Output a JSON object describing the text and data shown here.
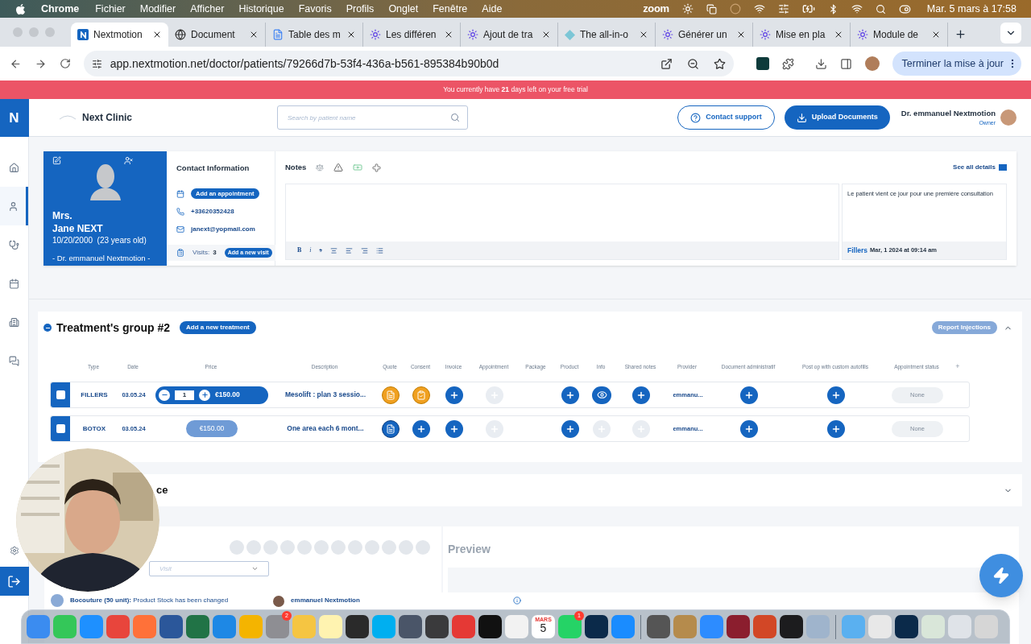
{
  "menu_bar": {
    "app": "Chrome",
    "menus": [
      "Fichier",
      "Modifier",
      "Afficher",
      "Historique",
      "Favoris",
      "Profils",
      "Onglet",
      "Fenêtre",
      "Aide"
    ],
    "zoom_label": "zoom",
    "clock": "Mar. 5 mars à 17:58"
  },
  "browser": {
    "tabs": [
      {
        "title": "Nextmotion",
        "kind": "nextmotion",
        "selected": true
      },
      {
        "title": "Document",
        "kind": "globe",
        "selected": false
      },
      {
        "title": "Table des m",
        "kind": "docs",
        "selected": false
      },
      {
        "title": "Les différen",
        "kind": "sparkle",
        "selected": false
      },
      {
        "title": "Ajout de tra",
        "kind": "sparkle",
        "selected": false
      },
      {
        "title": "The all-in-o",
        "kind": "diamond",
        "selected": false
      },
      {
        "title": "Générer un",
        "kind": "sparkle",
        "selected": false
      },
      {
        "title": "Mise en pla",
        "kind": "sparkle",
        "selected": false
      },
      {
        "title": "Module de",
        "kind": "sparkle",
        "selected": false
      }
    ],
    "url": "app.nextmotion.net/doctor/patients/79266d7b-53f4-436a-b561-895384b90b0d",
    "update_button": "Terminer la mise à jour"
  },
  "trial_banner": "You currently have **21** days left on your free trial",
  "sidebar": {
    "logo": "N",
    "items": [
      {
        "kind": "home",
        "selected": false
      },
      {
        "kind": "user",
        "selected": true
      },
      {
        "kind": "stethoscope",
        "selected": false
      },
      {
        "kind": "calendar",
        "selected": false
      },
      {
        "kind": "building",
        "selected": false
      },
      {
        "kind": "chat",
        "selected": false
      }
    ]
  },
  "header": {
    "clinic": "Next Clinic",
    "search_placeholder": "Search by patient name",
    "contact_support": "Contact support",
    "upload": "Upload Documents",
    "user_name": "Dr. emmanuel Nextmotion",
    "user_role": "Owner"
  },
  "patient": {
    "title": "Mrs.",
    "name": "Jane NEXT",
    "birth": "10/20/2000  (23 years old)",
    "doctor": "- Dr. emmanuel Nextmotion -"
  },
  "contact": {
    "heading": "Contact Information",
    "appointment_button": "Add an appointment",
    "phone": "+33620352428",
    "email": "janext@yopmail.com",
    "visits_label": "Visits:",
    "visits_count": "3",
    "visit_button": "Add a new visit"
  },
  "notes": {
    "title": "Notes",
    "format_buttons": [
      "B",
      "i",
      "s"
    ],
    "see_all": "See all details",
    "last_note": {
      "text": "Le patient vient ce jour pour une première consultation",
      "tag": "Fillers",
      "date": "Mar, 1 2024 at 09:14 am"
    }
  },
  "treatment_group": {
    "title": "Treatment's group #2",
    "add_button": "Add a new treatment",
    "report_button": "Report Injections",
    "expanded": true,
    "columns": [
      "Type",
      "Date",
      "Price",
      "Description",
      "Quote",
      "Consent",
      "Invoice",
      "Appointment",
      "Package",
      "Product",
      "Info",
      "Shared notes",
      "Provider",
      "Document administratif",
      "Post op with custom autofills",
      "Appointment status",
      "+"
    ],
    "rows": [
      {
        "checked": false,
        "type": "FILLERS",
        "date": "03.05.24",
        "price": {
          "kind": "stepper",
          "quantity": "1",
          "amount": "€150.00"
        },
        "description": "Mesolift : plan 3 sessio...",
        "actions": [
          {
            "kind": "document",
            "completed": true
          },
          {
            "kind": "checklist",
            "completed": true
          },
          {
            "kind": "add",
            "disabled": false
          },
          {
            "kind": "add",
            "disabled": true
          },
          {
            "kind": "empty"
          },
          {
            "kind": "add",
            "disabled": false
          },
          {
            "kind": "view",
            "disabled": false
          },
          {
            "kind": "add",
            "disabled": false
          }
        ],
        "provider": "emmanu...",
        "post_actions": [
          {
            "kind": "add",
            "disabled": false
          },
          {
            "kind": "add",
            "disabled": false
          }
        ],
        "status": "None"
      },
      {
        "checked": false,
        "type": "BOTOX",
        "date": "03.05.24",
        "price": {
          "kind": "pill",
          "amount": "€150.00"
        },
        "description": "One area each 6 mont...",
        "actions": [
          {
            "kind": "document",
            "completed": false
          },
          {
            "kind": "add",
            "disabled": false
          },
          {
            "kind": "add",
            "disabled": false
          },
          {
            "kind": "add",
            "disabled": true
          },
          {
            "kind": "empty"
          },
          {
            "kind": "add",
            "disabled": false
          },
          {
            "kind": "add",
            "disabled": true
          },
          {
            "kind": "add",
            "disabled": true
          }
        ],
        "provider": "emmanu...",
        "post_actions": [
          {
            "kind": "add",
            "disabled": false
          },
          {
            "kind": "add",
            "disabled": false
          }
        ],
        "status": "None"
      }
    ]
  },
  "collapsed_section": {
    "title": "ce",
    "expanded": false
  },
  "visit_panel": {
    "visit_placeholder": "Visit",
    "preview_title": "Preview",
    "activity": {
      "text": "**Bocouture (50 unit):** Product Stock has been changed",
      "author": "emmanuel Nextmotion"
    }
  },
  "dock": [
    {
      "kind": "app",
      "color": "#3b8cf0"
    },
    {
      "kind": "app",
      "color": "#34c759"
    },
    {
      "kind": "app",
      "color": "#1e90ff"
    },
    {
      "kind": "app",
      "color": "#e8453c"
    },
    {
      "kind": "app",
      "color": "#ff7139"
    },
    {
      "kind": "app",
      "color": "#2b579a"
    },
    {
      "kind": "app",
      "color": "#217346"
    },
    {
      "kind": "app",
      "color": "#1e88e5"
    },
    {
      "kind": "app",
      "color": "#f4b400"
    },
    {
      "kind": "app",
      "color": "#8e8e93",
      "badge": "2"
    },
    {
      "kind": "app",
      "color": "#f5c542"
    },
    {
      "kind": "app",
      "color": "#fff3b0"
    },
    {
      "kind": "app",
      "color": "#2a2a2a"
    },
    {
      "kind": "app",
      "color": "#00aff0"
    },
    {
      "kind": "app",
      "color": "#4a5568"
    },
    {
      "kind": "app",
      "color": "#3a3a3c"
    },
    {
      "kind": "app",
      "color": "#e53935"
    },
    {
      "kind": "app",
      "color": "#111111"
    },
    {
      "kind": "app",
      "color": "#f2f2f2"
    },
    {
      "kind": "calendar",
      "month": "MARS",
      "day": "5"
    },
    {
      "kind": "app",
      "color": "#25d366",
      "badge": "1"
    },
    {
      "kind": "app",
      "color": "#0b2a4a"
    },
    {
      "kind": "app",
      "color": "#1a8cff"
    },
    {
      "kind": "separator"
    },
    {
      "kind": "app",
      "color": "#555555"
    },
    {
      "kind": "app",
      "color": "#b58b4c"
    },
    {
      "kind": "app",
      "color": "#2d8cff"
    },
    {
      "kind": "app",
      "color": "#8b1e2e"
    },
    {
      "kind": "app",
      "color": "#d24726"
    },
    {
      "kind": "app",
      "color": "#1c1c1e"
    },
    {
      "kind": "app",
      "color": "#9fb4cc"
    },
    {
      "kind": "separator"
    },
    {
      "kind": "app",
      "color": "#5ab0f0"
    },
    {
      "kind": "app",
      "color": "#e8e8e8"
    },
    {
      "kind": "app",
      "color": "#0b2a4a"
    },
    {
      "kind": "app",
      "color": "#d9e6d9"
    },
    {
      "kind": "app",
      "color": "#dfe3e8"
    },
    {
      "kind": "app",
      "color": "#d6d6d6"
    }
  ]
}
